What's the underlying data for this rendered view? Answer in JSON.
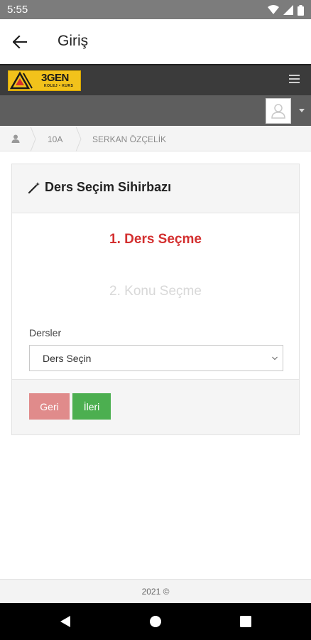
{
  "status_bar": {
    "time": "5:55",
    "icons": [
      "wifi-icon",
      "signal-icon",
      "battery-icon"
    ]
  },
  "app_bar": {
    "title": "Giriş",
    "back_icon": "arrow-left-icon"
  },
  "header": {
    "logo_text": "3GEN",
    "logo_subtext": "KOLEJ • KURS",
    "menu_icon": "hamburger-icon",
    "avatar_icon": "user-icon"
  },
  "breadcrumb": {
    "home_icon": "user-icon",
    "items": [
      "10A",
      "SERKAN ÖZÇELİK"
    ]
  },
  "wizard": {
    "title": "Ders Seçim Sihirbazı",
    "title_icon": "magic-wand-icon",
    "step_active": "1. Ders Seçme",
    "step_inactive": "2. Konu Seçme",
    "field_label": "Dersler",
    "select_value": "Ders Seçin",
    "back_button": "Geri",
    "next_button": "İleri"
  },
  "footer": {
    "copyright": "2021 ©"
  },
  "nav_bar": {
    "icons": [
      "back-triangle-icon",
      "home-circle-icon",
      "recents-square-icon"
    ]
  },
  "colors": {
    "active_step": "#d32f2f",
    "next_button": "#4caf50",
    "back_button": "#e08b8b",
    "logo": "#f2c21b",
    "header": "#3b3b3b"
  }
}
